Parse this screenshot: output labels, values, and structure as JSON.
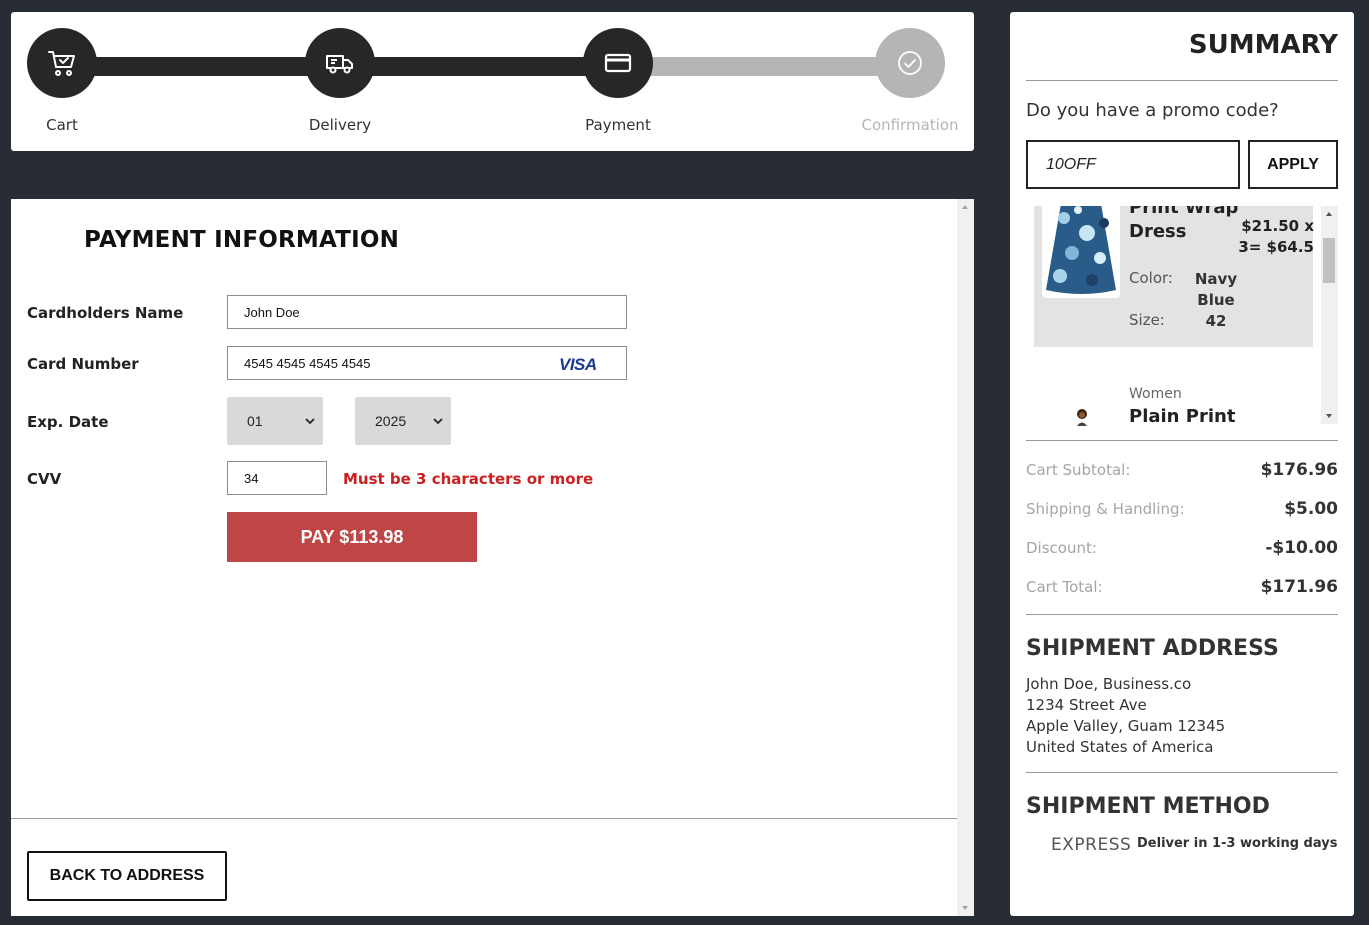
{
  "stepper": {
    "steps": [
      {
        "label": "Cart",
        "icon": "cart-icon",
        "state": "done"
      },
      {
        "label": "Delivery",
        "icon": "truck-icon",
        "state": "done"
      },
      {
        "label": "Payment",
        "icon": "credit-card-icon",
        "state": "active"
      },
      {
        "label": "Confirmation",
        "icon": "check-circle-icon",
        "state": "pending"
      }
    ]
  },
  "payment": {
    "title": "PAYMENT INFORMATION",
    "cardholder_label": "Cardholders Name",
    "cardholder_value": "John Doe",
    "card_number_label": "Card Number",
    "card_number_value": "4545 4545 4545 4545",
    "card_brand": "VISA",
    "exp_label": "Exp. Date",
    "exp_month": "01",
    "exp_year": "2025",
    "cvv_label": "CVV",
    "cvv_value": "34",
    "cvv_error": "Must be 3 characters or more",
    "pay_button": "PAY $113.98",
    "back_button": "BACK TO ADDRESS"
  },
  "summary": {
    "title": "SUMMARY",
    "promo_question": "Do you have a promo code?",
    "promo_value": "10OFF",
    "apply_button": "APPLY",
    "items": [
      {
        "name": "Print Wrap Dress",
        "price": "$21.50 x 3= $64.5",
        "color_label": "Color:",
        "color_value": "Navy Blue",
        "size_label": "Size:",
        "size_value": "42"
      },
      {
        "category": "Women",
        "name": "Plain Print"
      }
    ],
    "totals": [
      {
        "label": "Cart Subtotal:",
        "value": "$176.96"
      },
      {
        "label": "Shipping & Handling:",
        "value": "$5.00"
      },
      {
        "label": "Discount:",
        "value": "-$10.00"
      },
      {
        "label": "Cart Total:",
        "value": "$171.96"
      }
    ],
    "shipment_address_title": "SHIPMENT ADDRESS",
    "address_lines": [
      "John Doe, Business.co",
      "1234 Street Ave",
      "Apple Valley, Guam 12345",
      "United States of America"
    ],
    "shipment_method_title": "SHIPMENT METHOD",
    "method_name": "EXPRESS",
    "method_desc": "Deliver in 1-3 working days"
  },
  "colors": {
    "background": "#272c35",
    "step_done": "#272727",
    "step_pending": "#b5b5b5",
    "pay_button": "#c04545",
    "error": "#cc1f1f",
    "visa": "#1a3a8f"
  }
}
